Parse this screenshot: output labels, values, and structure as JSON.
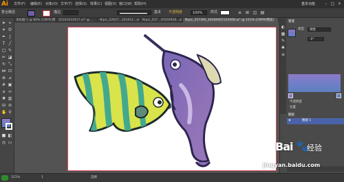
{
  "app": {
    "logo": "Ai",
    "workspace": "基本功能"
  },
  "menu": [
    "文件(F)",
    "编辑(E)",
    "对象(O)",
    "文字(T)",
    "选择(S)",
    "效果(C)",
    "视图(V)",
    "窗口(W)",
    "帮助(H)"
  ],
  "control_bar": {
    "object_label": "复合路径",
    "stroke_label": "描边",
    "brush_label": "基本",
    "opacity_label": "不透明度",
    "opacity_value": "100%",
    "style_label": "样式"
  },
  "tabs": [
    "未标题-1 @ 80% (CMYK/预览)",
    "20161031617.ai* @ ...",
    "Nipic_22627...201611...ai",
    "Nipic_537...20160928...ai",
    "Nipic_537395_20160925121008.ai* @ 121% (CMYK/预览)"
  ],
  "active_tab": 4,
  "panel": {
    "gradient_tab": "渐变",
    "type_label": "类型",
    "type_value": "线性",
    "angle_value": "-0°",
    "opacity_label": "不透明度",
    "location_label": "位置",
    "layers_tab": "图层",
    "layer_name": "图层 1"
  },
  "status": {
    "zoom": "121%",
    "page": "1",
    "mode": "选择"
  },
  "watermark": {
    "brand": "Bai",
    "cn": "经验",
    "url": "jingyan.baidu.com"
  },
  "colors": {
    "angelfish_yellow": "#d9e34a",
    "angelfish_stripe": "#43a98e",
    "marlin_purple": "#8b6eb8",
    "marlin_belly": "#b7a4d6",
    "artboard_border": "#d94b5a",
    "ai_orange": "#ff9a00"
  }
}
